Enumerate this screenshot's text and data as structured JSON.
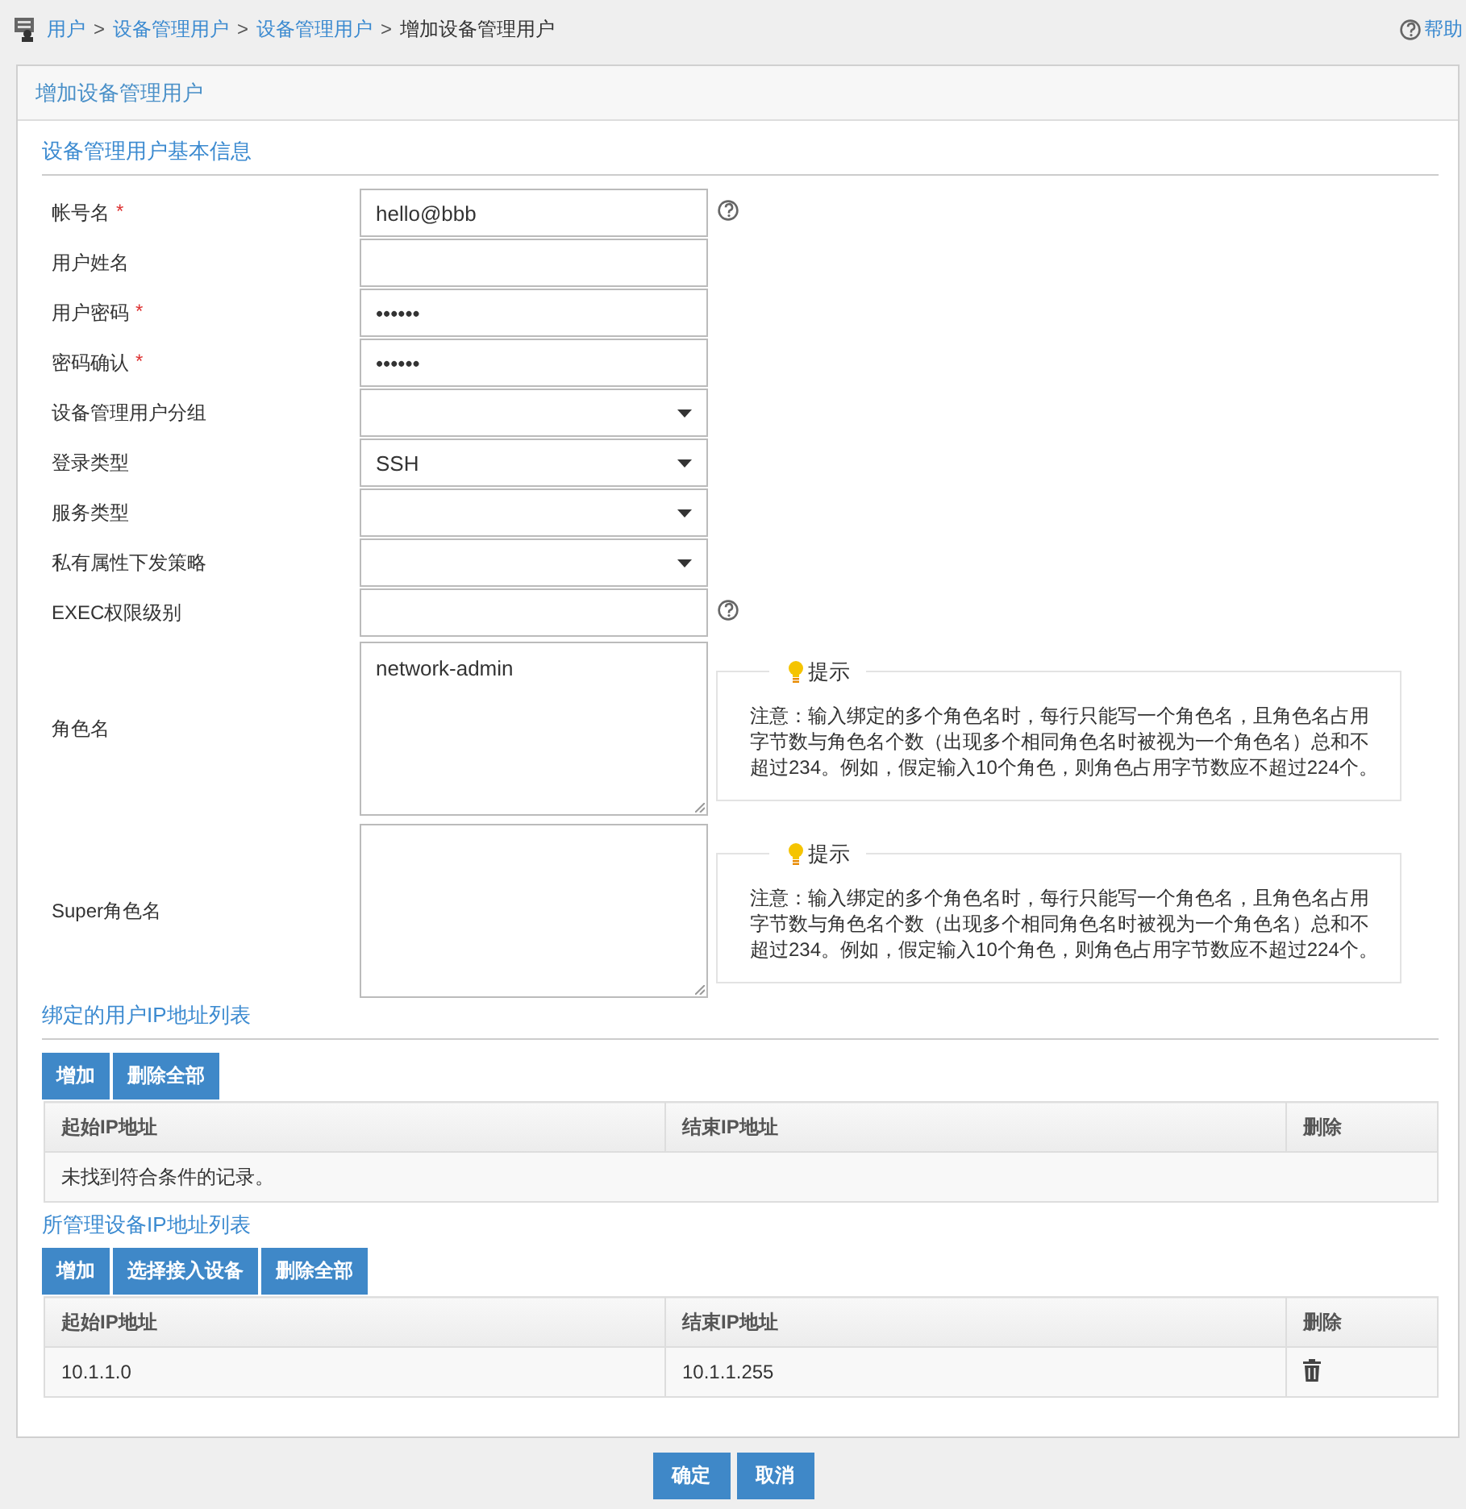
{
  "breadcrumb": {
    "items": [
      {
        "label": "用户",
        "link": true
      },
      {
        "label": "设备管理用户",
        "link": true
      },
      {
        "label": "设备管理用户",
        "link": true
      },
      {
        "label": "增加设备管理用户",
        "link": false
      }
    ],
    "separator": ">"
  },
  "help": "帮助",
  "required_mark": "*",
  "panel_title": "增加设备管理用户",
  "section_title": "设备管理用户基本信息",
  "fields": [
    {
      "label": "帐号名",
      "required": true,
      "kind": "text",
      "value": "hello@bbb",
      "help": true
    },
    {
      "label": "用户姓名",
      "required": false,
      "kind": "text",
      "help": false
    },
    {
      "label": "用户密码",
      "required": true,
      "kind": "password",
      "value": "••••••",
      "help": false
    },
    {
      "label": "密码确认",
      "required": true,
      "kind": "password",
      "value": "••••••",
      "help": false
    },
    {
      "label": "设备管理用户分组",
      "required": false,
      "kind": "select",
      "help": false
    },
    {
      "label": "登录类型",
      "required": false,
      "kind": "select",
      "value": "SSH",
      "help": false
    },
    {
      "label": "服务类型",
      "required": false,
      "kind": "select",
      "help": false
    },
    {
      "label": "私有属性下发策略",
      "required": false,
      "kind": "select",
      "help": false
    },
    {
      "label": "EXEC权限级别",
      "required": false,
      "kind": "text",
      "help": true
    },
    {
      "label": "角色名",
      "required": false,
      "kind": "textarea",
      "value": "network-admin",
      "hint": {
        "title": "提示",
        "text": "注意：输入绑定的多个角色名时，每行只能写一个角色名，且角色名占用字节数与角色名个数（出现多个相同角色名时被视为一个角色名）总和不超过234。例如，假定输入10个角色，则角色占用字节数应不超过224个。"
      }
    },
    {
      "label": "Super角色名",
      "required": false,
      "kind": "textarea",
      "hint": {
        "title": "提示",
        "text": "注意：输入绑定的多个角色名时，每行只能写一个角色名，且角色名占用字节数与角色名个数（出现多个相同角色名时被视为一个角色名）总和不超过234。例如，假定输入10个角色，则角色占用字节数应不超过224个。"
      }
    }
  ],
  "tables": [
    {
      "title": "绑定的用户IP地址列表",
      "underlined": true,
      "buttons": [
        "增加",
        "删除全部"
      ],
      "columns": [
        "起始IP地址",
        "结束IP地址",
        "删除"
      ],
      "empty_text": "未找到符合条件的记录。"
    },
    {
      "title": "所管理设备IP地址列表",
      "underlined": false,
      "buttons": [
        "增加",
        "选择接入设备",
        "删除全部"
      ],
      "columns": [
        "起始IP地址",
        "结束IP地址",
        "删除"
      ],
      "rows": [
        {
          "start": "10.1.1.0",
          "end": "10.1.1.255"
        }
      ]
    }
  ],
  "footer_buttons": [
    "确定",
    "取消"
  ]
}
